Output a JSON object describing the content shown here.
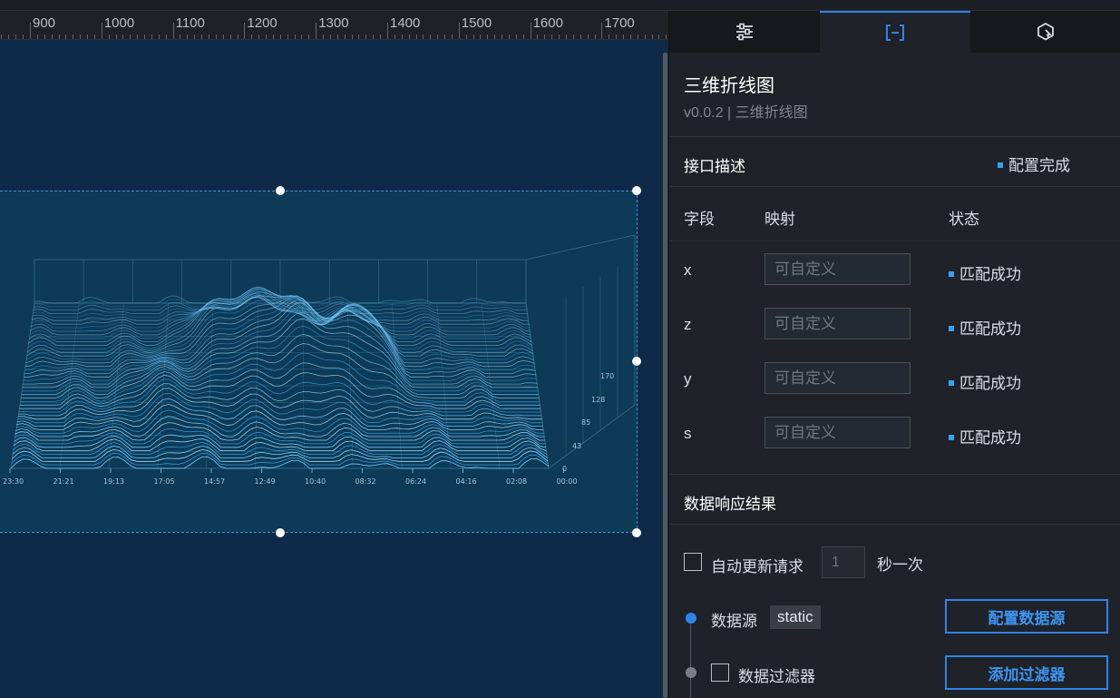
{
  "ruler": {
    "labels": [
      "900",
      "1000",
      "1100",
      "1200",
      "1300",
      "1400",
      "1500",
      "1600",
      "1700"
    ]
  },
  "chart_data": {
    "type": "line",
    "title": "",
    "x_tick_labels": [
      "23:30",
      "21:21",
      "19:13",
      "17:05",
      "14:57",
      "12:49",
      "10:40",
      "08:32",
      "06:24",
      "04:16",
      "02:08",
      "00:00"
    ],
    "z_tick_labels": [
      "0",
      "43",
      "85",
      "128",
      "170"
    ],
    "grid": true,
    "line_color": "#7fd0ff"
  },
  "panel": {
    "tabs": [
      {
        "icon": "sliders-icon"
      },
      {
        "icon": "data-bracket-icon"
      },
      {
        "icon": "interaction-icon"
      }
    ],
    "title": "三维折线图",
    "subtitle": "v0.0.2 | 三维折线图",
    "interface": {
      "heading": "接口描述",
      "status": "配置完成",
      "columns": {
        "field": "字段",
        "mapping": "映射",
        "status": "状态"
      },
      "rows": [
        {
          "field": "x",
          "placeholder": "可自定义",
          "status": "匹配成功"
        },
        {
          "field": "z",
          "placeholder": "可自定义",
          "status": "匹配成功"
        },
        {
          "field": "y",
          "placeholder": "可自定义",
          "status": "匹配成功"
        },
        {
          "field": "s",
          "placeholder": "可自定义",
          "status": "匹配成功"
        }
      ]
    },
    "response": {
      "heading": "数据响应结果",
      "auto_update_label": "自动更新请求",
      "interval_placeholder": "1",
      "interval_unit": "秒一次",
      "source_label": "数据源",
      "source_value": "static",
      "config_source_button": "配置数据源",
      "filter_label": "数据过滤器",
      "add_filter_button": "添加过滤器"
    },
    "colors": {
      "accent": "#2f84e8",
      "status_dot": "#2fa6f1"
    }
  }
}
